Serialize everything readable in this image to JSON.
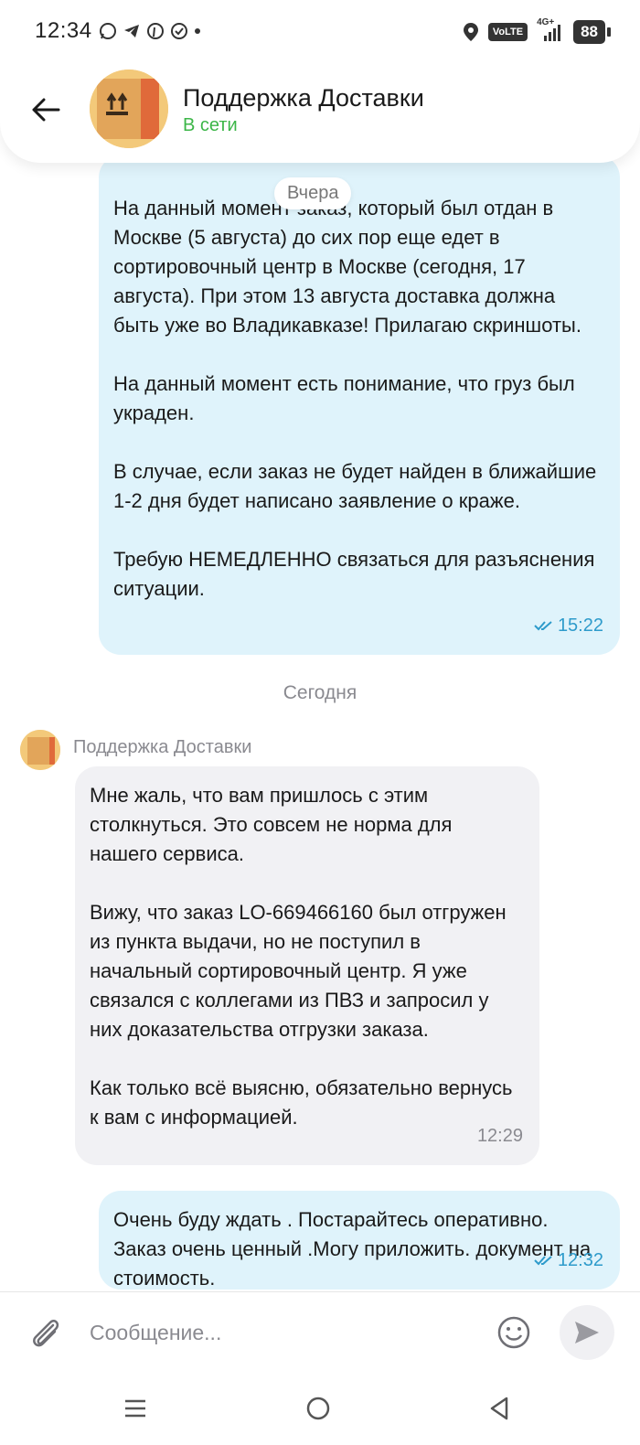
{
  "status_bar": {
    "time": "12:34",
    "volte": "VoLTE",
    "network": "4G+",
    "battery": "88"
  },
  "header": {
    "title": "Поддержка Доставки",
    "status": "В сети",
    "status_color": "#3cb648"
  },
  "chat": {
    "date_yesterday": "Вчера",
    "date_today": "Сегодня",
    "messages": [
      {
        "direction": "outgoing",
        "text": "На данный момент заказ, который был отдан в Москве (5 августа) до сих пор еще едет в сортировочный центр в Москве (сегодня, 17 августа). При этом 13 августа доставка должна быть уже во Владикавказе! Прилагаю скриншоты.\n\nНа данный момент есть понимание, что груз был украден.\n\nВ случае, если заказ не будет найден в ближайшие 1-2 дня будет написано заявление о краже.\n\nТребую НЕМЕДЛЕННО связаться для разъяснения ситуации.",
        "time": "15:22",
        "read": true
      },
      {
        "direction": "incoming",
        "sender": "Поддержка Доставки",
        "text": "Мне жаль, что вам пришлось с этим столкнуться. Это совсем не норма для нашего сервиса.\n\nВижу, что заказ LO-669466160 был отгружен из пункта выдачи, но не поступил в начальный сортировочный центр. Я уже связался с коллегами из ПВЗ и запросил у них доказательства отгрузки заказа.\n\nКак только всё выясню, обязательно вернусь к вам с информацией.",
        "time": "12:29"
      },
      {
        "direction": "outgoing",
        "text": "Очень буду ждать . Постарайтесь оперативно. Заказ очень ценный .Могу приложить. документ на стоимость.",
        "time": "12:32",
        "read": true
      }
    ]
  },
  "input": {
    "placeholder": "Сообщение..."
  },
  "icons": {
    "back": "arrow-left-icon",
    "attach": "paperclip-icon",
    "emoji": "smiley-icon",
    "send": "send-icon",
    "read": "double-check-icon"
  },
  "colors": {
    "outgoing_bubble": "#dff3fb",
    "incoming_bubble": "#f1f1f4",
    "read_check": "#2e9bcb"
  }
}
